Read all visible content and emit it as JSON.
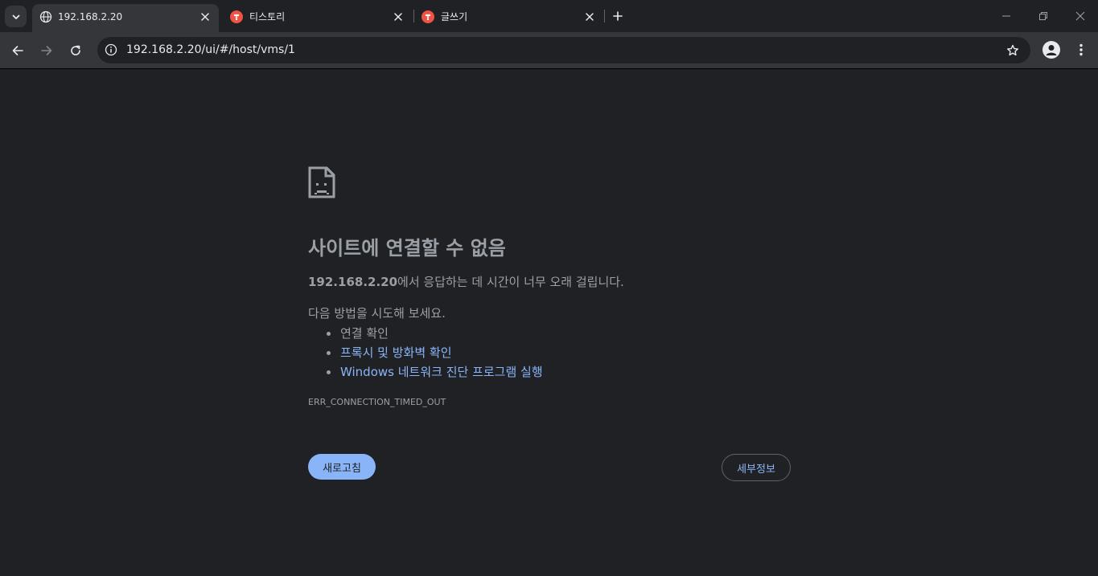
{
  "tabs": [
    {
      "title": "192.168.2.20",
      "active": true,
      "favicon": "globe-icon"
    },
    {
      "title": "티스토리",
      "active": false,
      "favicon": "tistory-icon"
    },
    {
      "title": "글쓰기",
      "active": false,
      "favicon": "tistory-icon"
    }
  ],
  "omnibox": {
    "url": "192.168.2.20/ui/#/host/vms/1"
  },
  "error": {
    "heading": "사이트에 연결할 수 없음",
    "host": "192.168.2.20",
    "message": "에서 응답하는 데 시간이 너무 오래 걸립니다.",
    "try_label": "다음 방법을 시도해 보세요.",
    "suggestions": [
      {
        "text": "연결 확인",
        "link": false
      },
      {
        "text": "프록시 및 방화벽 확인",
        "link": true
      },
      {
        "text": "Windows 네트워크 진단 프로그램 실행",
        "link": true
      }
    ],
    "code": "ERR_CONNECTION_TIMED_OUT",
    "reload_label": "새로고침",
    "details_label": "세부정보"
  },
  "colors": {
    "background": "#202124",
    "toolbar": "#35363a",
    "text": "#9aa0a6",
    "link": "#8ab4f8",
    "tistory": "#ef5343"
  }
}
